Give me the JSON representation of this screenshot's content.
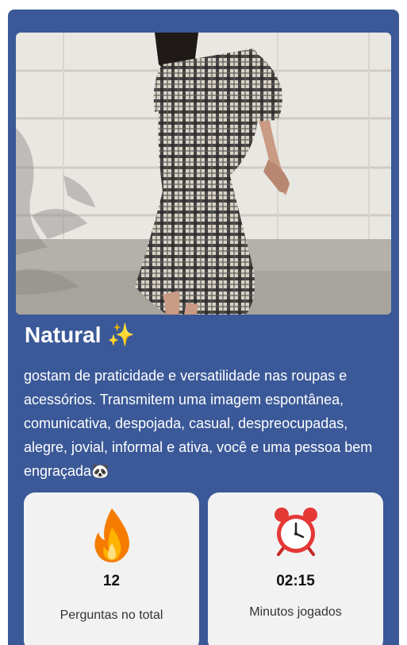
{
  "result": {
    "title": "Natural ✨",
    "description": "gostam de praticidade e versatilidade nas roupas e acessórios. Transmitem uma imagem espontânea, comunicativa, despojada, casual, despreocupadas, alegre, jovial, informal e ativa, você e uma pessoa bem engraçada🐼",
    "image_subject": "person-in-plaid-dress-photo"
  },
  "stats": [
    {
      "icon": "fire-icon",
      "value": "12",
      "label": "Perguntas no total"
    },
    {
      "icon": "alarm-clock-icon",
      "value": "02:15",
      "label": "Minutos jogados"
    }
  ],
  "colors": {
    "card_background": "#3b5998",
    "stat_background": "#f2f2f2",
    "text_light": "#ffffff",
    "text_dark": "#111111"
  }
}
